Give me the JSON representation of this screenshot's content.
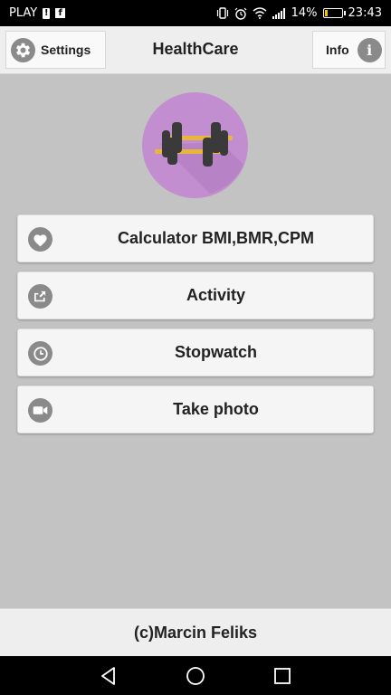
{
  "status_bar": {
    "carrier": "PLAY",
    "battery_percent": "14%",
    "battery_level": 0.14,
    "time": "23:43",
    "icons": [
      "alert-icon",
      "facebook-icon",
      "vibrate-icon",
      "alarm-icon",
      "wifi-icon",
      "signal-icon",
      "battery-icon"
    ]
  },
  "action_bar": {
    "title": "HealthCare",
    "settings_label": "Settings",
    "settings_icon": "gear-icon",
    "info_label": "Info",
    "info_icon": "info-icon",
    "info_glyph": "i"
  },
  "logo": {
    "icon": "dumbbell-icon",
    "background_color": "#c38ed0"
  },
  "menu": {
    "items": [
      {
        "label": "Calculator BMI,BMR,CPM",
        "icon": "heart-icon"
      },
      {
        "label": "Activity",
        "icon": "share-icon"
      },
      {
        "label": "Stopwatch",
        "icon": "clock-icon"
      },
      {
        "label": "Take photo",
        "icon": "video-camera-icon"
      }
    ]
  },
  "footer": {
    "text": "(c)Marcin Feliks"
  },
  "nav_bar": {
    "icons": [
      "back-icon",
      "home-icon",
      "recents-icon"
    ]
  },
  "colors": {
    "background": "#c3c3c3",
    "bar": "#eeeeee",
    "icon_gray": "#8a8a8a",
    "battery_low": "#f5c400"
  }
}
